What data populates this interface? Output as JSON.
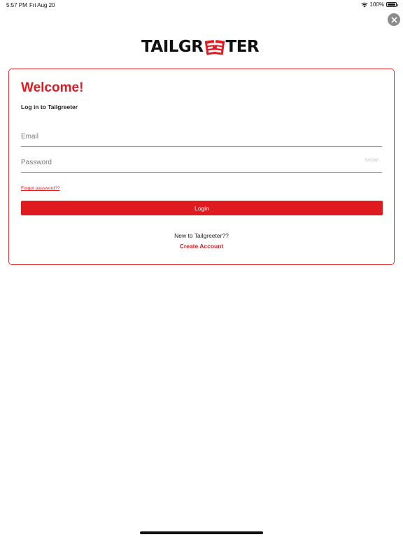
{
  "status_bar": {
    "time": "5:57 PM",
    "date": "Fri Aug 20",
    "battery": "100%"
  },
  "logo": {
    "part1": "TAILGR",
    "part2": "TER"
  },
  "login_card": {
    "title": "Welcome!",
    "subtitle": "Log in to Tailgreeter",
    "email": {
      "value": "",
      "placeholder": "Email"
    },
    "password": {
      "value": "",
      "placeholder": "Password",
      "toggle_label": "SHOW"
    },
    "forgot_password": "Forgot password??",
    "login_button": "Login",
    "new_prompt": "New to Tailgreeter??",
    "create_account": "Create Account"
  },
  "colors": {
    "accent": "#e01b22",
    "border": "#e0303a",
    "close_bg": "#8a8a8f"
  },
  "icons": {
    "close": "close-icon",
    "wifi": "wifi-icon",
    "battery": "battery-icon"
  }
}
